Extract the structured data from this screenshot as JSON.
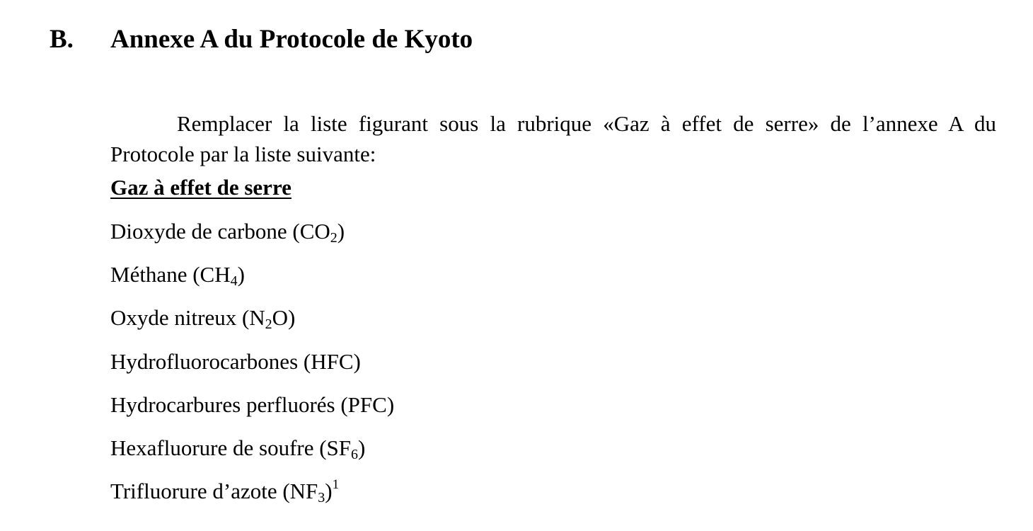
{
  "section": {
    "number": "B.",
    "title": "Annexe A du Protocole de Kyoto"
  },
  "paragraph": "Remplacer la liste figurant sous la rubrique «Gaz à effet de serre» de l’annexe A du Protocole par la liste suivante:",
  "list_heading": "Gaz à effet de serre",
  "gases": [
    {
      "name": "Dioxyde de carbone (CO",
      "sub": "2",
      "after": ")",
      "note": ""
    },
    {
      "name": "Méthane (CH",
      "sub": "4",
      "after": ")",
      "note": ""
    },
    {
      "name": "Oxyde nitreux (N",
      "sub": "2",
      "after": "O)",
      "note": ""
    },
    {
      "name": "Hydrofluorocarbones (HFC)",
      "sub": "",
      "after": "",
      "note": ""
    },
    {
      "name": "Hydrocarbures perfluorés (PFC)",
      "sub": "",
      "after": "",
      "note": ""
    },
    {
      "name": "Hexafluorure de soufre (SF",
      "sub": "6",
      "after": ")",
      "note": ""
    },
    {
      "name": "Trifluorure d’azote (NF",
      "sub": "3",
      "after": ")",
      "note": "1"
    }
  ]
}
